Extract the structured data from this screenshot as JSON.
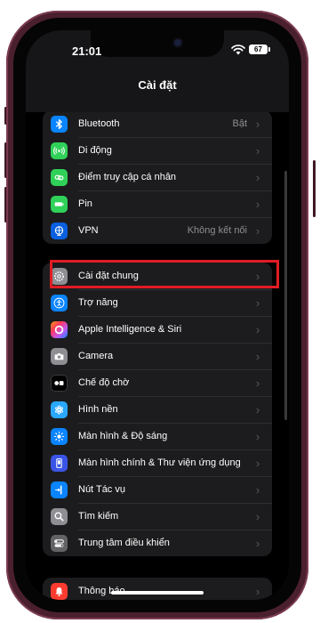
{
  "status_bar": {
    "time": "21:01",
    "battery": "67"
  },
  "nav": {
    "title": "Cài đặt"
  },
  "colors": {
    "bluetooth": "#0a84ff",
    "cellular": "#30d158",
    "hotspot": "#30d158",
    "battery": "#30d158",
    "vpn": "#0a60e0",
    "general": "#8e8e93",
    "accessibility": "#0a84ff",
    "camera": "#8e8e93",
    "standby": "#1c1c1e",
    "wallpaper": "#2aa8ff",
    "display": "#0a84ff",
    "home_screen": "#3a55e6",
    "action_button": "#0a84ff",
    "search": "#8e8e93",
    "control_center": "#636366",
    "notifications": "#ff3b30",
    "highlight": "#e01c24"
  },
  "group1": [
    {
      "label": "Bluetooth",
      "value": "Bật",
      "icon": "bluetooth-icon"
    },
    {
      "label": "Di động",
      "value": "",
      "icon": "cellular-icon"
    },
    {
      "label": "Điểm truy cập cá nhân",
      "value": "",
      "icon": "hotspot-icon"
    },
    {
      "label": "Pin",
      "value": "",
      "icon": "battery-icon"
    },
    {
      "label": "VPN",
      "value": "Không kết nối",
      "icon": "vpn-icon"
    }
  ],
  "group2": [
    {
      "label": "Cài đặt chung",
      "icon": "gear-icon"
    },
    {
      "label": "Trợ năng",
      "icon": "accessibility-icon"
    },
    {
      "label": "Apple Intelligence & Siri",
      "icon": "siri-icon"
    },
    {
      "label": "Camera",
      "icon": "camera-icon"
    },
    {
      "label": "Chế độ chờ",
      "icon": "standby-icon"
    },
    {
      "label": "Hình nền",
      "icon": "wallpaper-icon"
    },
    {
      "label": "Màn hình & Độ sáng",
      "icon": "brightness-icon"
    },
    {
      "label": "Màn hình chính & Thư viện ứng dụng",
      "icon": "home-screen-icon"
    },
    {
      "label": "Nút Tác vụ",
      "icon": "action-button-icon"
    },
    {
      "label": "Tìm kiếm",
      "icon": "search-icon"
    },
    {
      "label": "Trung tâm điều khiển",
      "icon": "control-center-icon"
    }
  ],
  "group3": [
    {
      "label": "Thông báo",
      "icon": "bell-icon"
    }
  ]
}
